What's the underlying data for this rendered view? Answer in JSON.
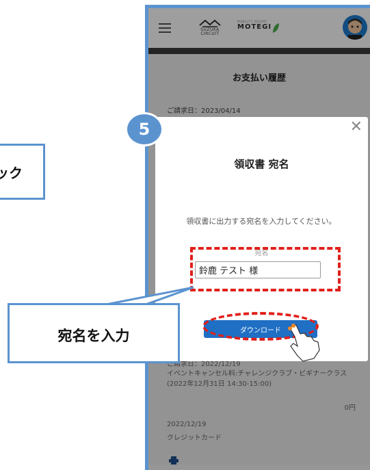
{
  "app": {
    "logo_suzuka": "SUZUKA CIRCUIT",
    "logo_motegi_small": "MOBILITY RESORT",
    "logo_motegi": "MOTEGI"
  },
  "page": {
    "title": "お支払い履歴",
    "invoice_top_date": "ご請求日：2023/04/14",
    "invoice2": {
      "date": "ご請求日：2022/12/19",
      "description": "イベントキャンセル料:チャレンジクラブ・ビギナークラス(2022年12月31日 14:30-15:00)",
      "amount": "0円",
      "pay_date": "2022/12/19",
      "method": "クレジットカード"
    }
  },
  "modal": {
    "title": "領収書 宛名",
    "instruction": "領収書に出力する宛名を入力してください。",
    "field_label": "宛名",
    "input_value": "鈴鹿 テスト 様",
    "download_label": "ダウンロード"
  },
  "annotations": {
    "step_number": "5",
    "click_callout": "ック",
    "input_callout": "宛名を入力"
  },
  "colors": {
    "frame_blue": "#5b93cf",
    "button_blue": "#1f6fc5",
    "highlight_red": "#e0201b",
    "motegi_leaf": "#4caf50"
  },
  "icons": [
    "menu-icon",
    "avatar",
    "close-icon",
    "print-icon",
    "cursor-hand-icon"
  ]
}
